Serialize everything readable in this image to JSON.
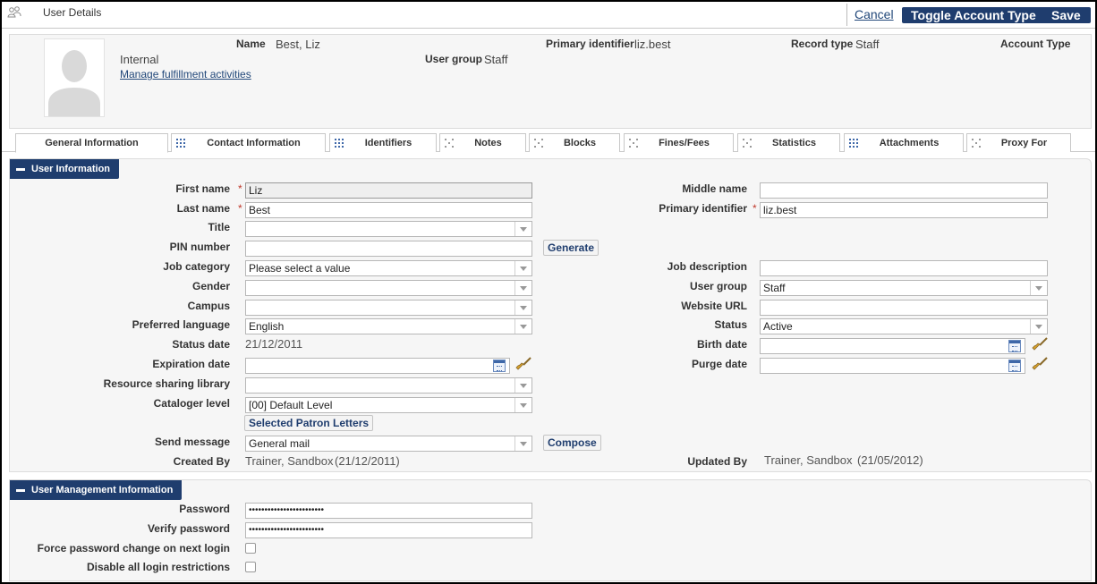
{
  "header": {
    "title": "User Details",
    "cancel_label": "Cancel",
    "toggle_label": "Toggle Account Type",
    "save_label": "Save"
  },
  "summary": {
    "name_label": "Name",
    "name_value": "Best, Liz",
    "primary_id_label": "Primary identifier",
    "primary_id_value": "liz.best",
    "record_type_label": "Record type",
    "record_type_value": "Staff",
    "account_type_label": "Account Type",
    "account_type_value": "Internal",
    "user_group_label": "User group",
    "user_group_value": "Staff",
    "fulfillment_link": "Manage fulfillment activities"
  },
  "tabs": [
    {
      "label": "General Information",
      "active": true
    },
    {
      "label": "Contact Information"
    },
    {
      "label": "Identifiers"
    },
    {
      "label": "Notes"
    },
    {
      "label": "Blocks"
    },
    {
      "label": "Fines/Fees"
    },
    {
      "label": "Statistics"
    },
    {
      "label": "Attachments"
    },
    {
      "label": "Proxy For"
    }
  ],
  "user_info": {
    "section_title": "User Information",
    "first_name": {
      "label": "First name",
      "value": "Liz"
    },
    "last_name": {
      "label": "Last name",
      "value": "Best"
    },
    "title": {
      "label": "Title",
      "value": ""
    },
    "pin": {
      "label": "PIN number",
      "value": "",
      "button": "Generate"
    },
    "job_category": {
      "label": "Job category",
      "value": "Please select a value"
    },
    "gender": {
      "label": "Gender",
      "value": ""
    },
    "campus": {
      "label": "Campus",
      "value": ""
    },
    "preferred_language": {
      "label": "Preferred language",
      "value": "English"
    },
    "status_date": {
      "label": "Status date",
      "value": "21/12/2011"
    },
    "expiration_date": {
      "label": "Expiration date",
      "value": ""
    },
    "resource_sharing": {
      "label": "Resource sharing library",
      "value": ""
    },
    "cataloger_level": {
      "label": "Cataloger level",
      "value": "[00] Default Level"
    },
    "patron_letters_button": "Selected Patron Letters",
    "send_message": {
      "label": "Send message",
      "value": "General mail",
      "button": "Compose"
    },
    "created_by": {
      "label": "Created By",
      "value": "Trainer, Sandbox",
      "date": "(21/12/2011)"
    },
    "middle_name": {
      "label": "Middle name",
      "value": ""
    },
    "primary_identifier": {
      "label": "Primary identifier",
      "value": "liz.best"
    },
    "job_description": {
      "label": "Job description",
      "value": ""
    },
    "user_group": {
      "label": "User group",
      "value": "Staff"
    },
    "website_url": {
      "label": "Website URL",
      "value": ""
    },
    "status": {
      "label": "Status",
      "value": "Active"
    },
    "birth_date": {
      "label": "Birth date",
      "value": ""
    },
    "purge_date": {
      "label": "Purge date",
      "value": ""
    },
    "updated_by": {
      "label": "Updated By",
      "value": "Trainer, Sandbox",
      "date": "(21/05/2012)"
    }
  },
  "user_mgmt": {
    "section_title": "User Management Information",
    "password": {
      "label": "Password",
      "value": "••••••••••••••••••••••••"
    },
    "verify_password": {
      "label": "Verify password",
      "value": "••••••••••••••••••••••••"
    },
    "force_change": {
      "label": "Force password change on next login",
      "checked": false
    },
    "disable_restrictions": {
      "label": "Disable all login restrictions",
      "checked": false
    }
  },
  "colors": {
    "primary": "#1f3d6e",
    "required": "#c0392b",
    "link": "#22487a"
  }
}
